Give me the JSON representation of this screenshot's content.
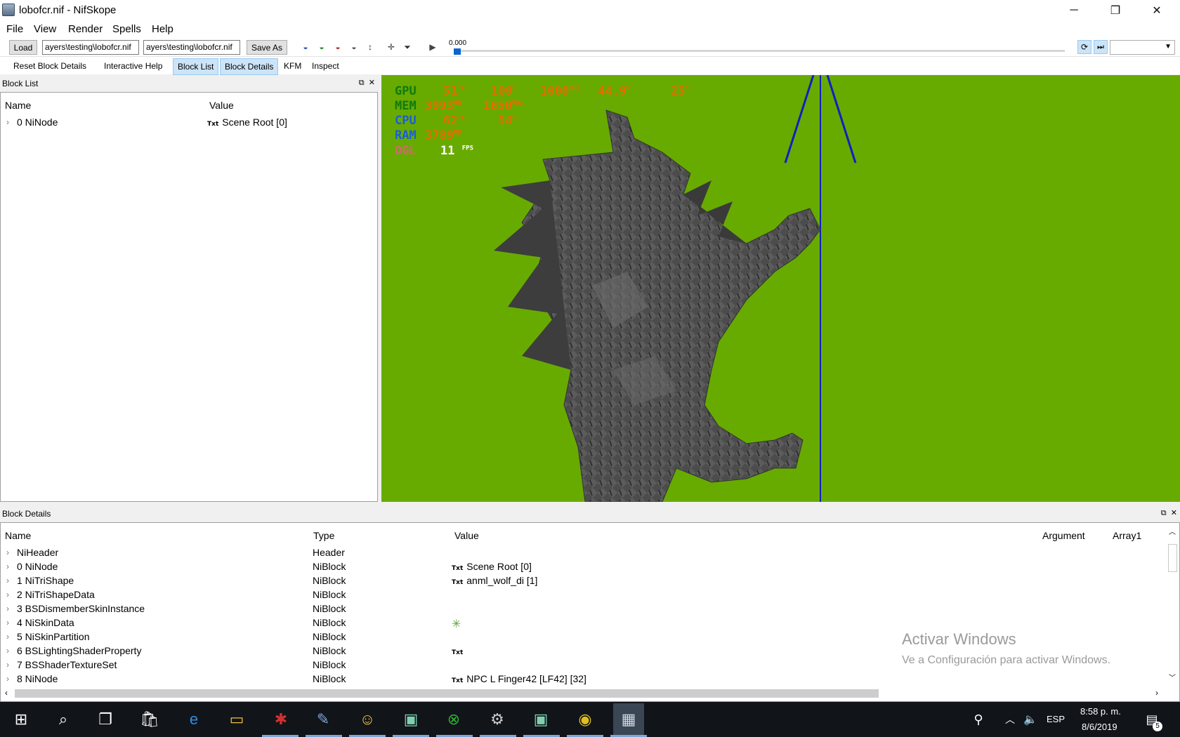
{
  "window": {
    "title": "lobofcr.nif - NifSkope",
    "minimize": "─",
    "maximize": "❐",
    "close": "✕"
  },
  "menu": [
    "File",
    "View",
    "Render",
    "Spells",
    "Help"
  ],
  "toolbar": {
    "load_label": "Load",
    "load_path": "ayers\\testing\\lobofcr.nif",
    "save_path": "ayers\\testing\\lobofcr.nif",
    "save_as_label": "Save As",
    "time_value": "0.000",
    "play_icon": "▶"
  },
  "toolbar2": [
    "Reset Block Details",
    "Interactive Help",
    "Block List",
    "Block Details",
    "KFM",
    "Inspect"
  ],
  "block_list": {
    "title": "Block List",
    "columns": [
      "Name",
      "Value"
    ],
    "rows": [
      {
        "name": "0 NiNode",
        "tag": "Txt",
        "value": "Scene Root [0]"
      }
    ]
  },
  "viewport": {
    "background": "#67ab00",
    "overlay": {
      "gpu_label": "GPU",
      "gpu_temp": "51",
      "gpu_temp_unit": "°C",
      "gpu_load": "100",
      "gpu_load_unit": "%",
      "gpu_clock": "1000",
      "gpu_clock_unit": "MHz",
      "gpu_power": "44.9",
      "gpu_power_unit": "W",
      "gpu_extra": "25",
      "gpu_extra_unit": "%",
      "mem_label": "MEM",
      "mem_used": "3993",
      "mem_used_unit": "MB",
      "mem_clock": "1650",
      "mem_clock_unit": "MHz",
      "cpu_label": "CPU",
      "cpu_temp": "62",
      "cpu_temp_unit": "°C",
      "cpu_load": "54",
      "cpu_load_unit": "%",
      "ram_label": "RAM",
      "ram_used": "3789",
      "ram_used_unit": "MB",
      "ogl_label": "OGL",
      "fps": "11",
      "fps_unit": "FPS"
    }
  },
  "block_details": {
    "title": "Block Details",
    "columns": [
      "Name",
      "Type",
      "Value",
      "Argument",
      "Array1"
    ],
    "rows": [
      {
        "name": "NiHeader",
        "type": "Header",
        "tag": "",
        "value": ""
      },
      {
        "name": "0 NiNode",
        "type": "NiBlock",
        "tag": "Txt",
        "value": "Scene Root [0]"
      },
      {
        "name": "1 NiTriShape",
        "type": "NiBlock",
        "tag": "Txt",
        "value": "anml_wolf_di [1]"
      },
      {
        "name": "2 NiTriShapeData",
        "type": "NiBlock",
        "tag": "",
        "value": ""
      },
      {
        "name": "3 BSDismemberSkinInstance",
        "type": "NiBlock",
        "tag": "",
        "value": ""
      },
      {
        "name": "4 NiSkinData",
        "type": "NiBlock",
        "tag": "✳",
        "value": ""
      },
      {
        "name": "5 NiSkinPartition",
        "type": "NiBlock",
        "tag": "",
        "value": ""
      },
      {
        "name": "6 BSLightingShaderProperty",
        "type": "NiBlock",
        "tag": "Txt",
        "value": ""
      },
      {
        "name": "7 BSShaderTextureSet",
        "type": "NiBlock",
        "tag": "",
        "value": ""
      },
      {
        "name": "8 NiNode",
        "type": "NiBlock",
        "tag": "Txt",
        "value": "NPC L Finger42 [LF42] [32]"
      }
    ]
  },
  "watermark": {
    "line1": "Activar Windows",
    "line2": "Ve a Configuración para activar Windows."
  },
  "taskbar": {
    "language": "ESP",
    "time": "8:58 p. m.",
    "date": "8/6/2019",
    "notifications": "5"
  }
}
